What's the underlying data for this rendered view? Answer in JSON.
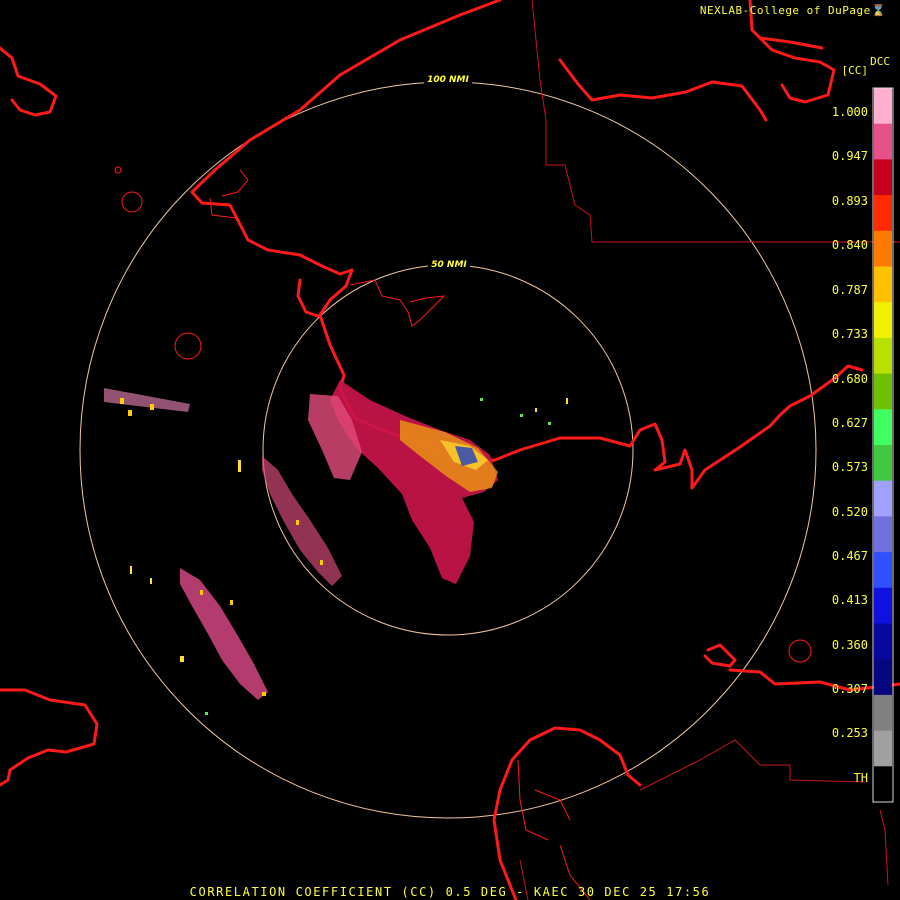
{
  "header": {
    "brand": "NEXLAB-College of DuPage",
    "icon": "flag-icon"
  },
  "legend": {
    "product": "DCC",
    "unit": "[CC]",
    "ticks": [
      "1.000",
      "0.947",
      "0.893",
      "0.840",
      "0.787",
      "0.733",
      "0.680",
      "0.627",
      "0.573",
      "0.520",
      "0.467",
      "0.413",
      "0.360",
      "0.307",
      "0.253",
      "TH"
    ]
  },
  "rings": [
    {
      "label": "50 NMI"
    },
    {
      "label": "100 NMI"
    }
  ],
  "footer": {
    "caption": "CORRELATION COEFFICIENT (CC) 0.5 DEG - KAEC 30 DEC 25 17:56"
  },
  "colors": {
    "coastline": "#ff1a1a",
    "borders": "#c8141e",
    "range_rings": "#f0c8a0",
    "text": "#ffff3a",
    "colorbar": [
      "#ffb0d0",
      "#e8508a",
      "#c80020",
      "#ff2a00",
      "#ff7a00",
      "#ffc000",
      "#f0f000",
      "#b8e000",
      "#70c000",
      "#40ff60",
      "#40c840",
      "#a0a0ff",
      "#7070e0",
      "#3050ff",
      "#1010e0",
      "#0808a0",
      "#060680",
      "#808080",
      "#a0a0a0",
      "#000000"
    ]
  }
}
